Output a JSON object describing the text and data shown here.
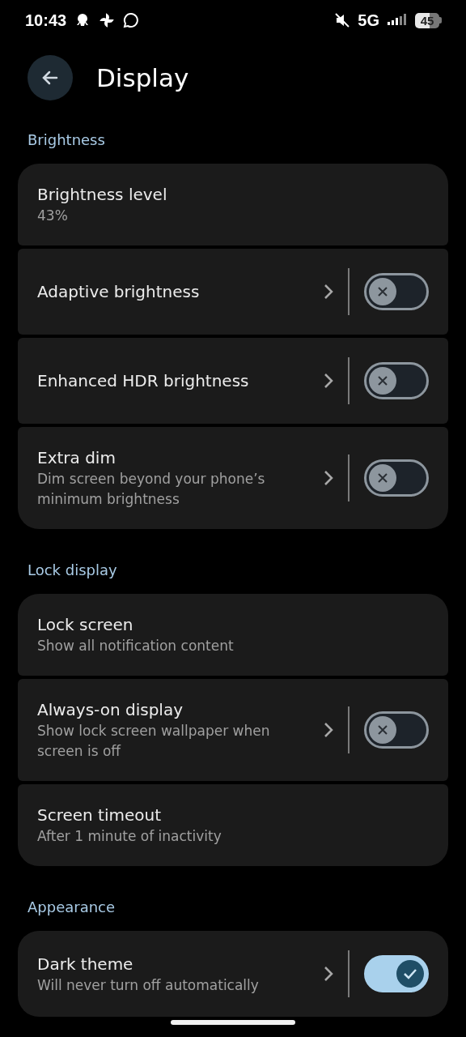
{
  "status_bar": {
    "time": "10:43",
    "network": "5G",
    "battery": "45"
  },
  "header": {
    "title": "Display"
  },
  "sections": [
    {
      "title": "Brightness",
      "items": [
        {
          "kind": "plain",
          "title": "Brightness level",
          "subtitle": "43%"
        },
        {
          "kind": "toggle",
          "title": "Adaptive brightness",
          "on": false
        },
        {
          "kind": "toggle",
          "title": "Enhanced HDR brightness",
          "on": false
        },
        {
          "kind": "toggle",
          "title": "Extra dim",
          "subtitle": "Dim screen beyond your phone’s minimum brightness",
          "on": false
        }
      ]
    },
    {
      "title": "Lock display",
      "items": [
        {
          "kind": "plain",
          "title": "Lock screen",
          "subtitle": "Show all notification content"
        },
        {
          "kind": "toggle",
          "title": "Always-on display",
          "subtitle": "Show lock screen wallpaper when screen is off",
          "on": false
        },
        {
          "kind": "plain",
          "title": "Screen timeout",
          "subtitle": "After 1 minute of inactivity"
        }
      ]
    },
    {
      "title": "Appearance",
      "items": [
        {
          "kind": "toggle",
          "title": "Dark theme",
          "subtitle": "Will never turn off automatically",
          "on": true
        }
      ]
    }
  ]
}
